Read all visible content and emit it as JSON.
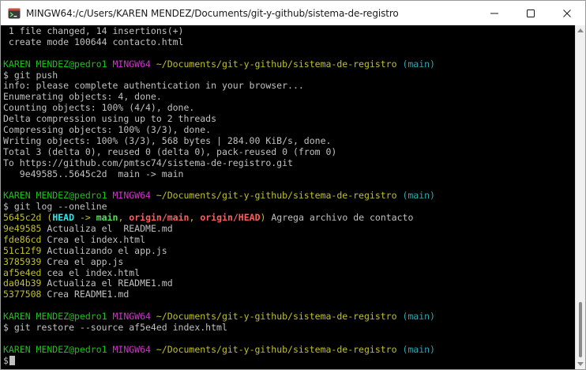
{
  "window": {
    "title": "MINGW64:/c/Users/KAREN MENDEZ/Documents/git-y-github/sistema-de-registro"
  },
  "icons": {
    "app": "mingw-terminal-icon",
    "minimize": "minimize-icon",
    "maximize": "maximize-icon",
    "close": "close-icon"
  },
  "colors": {
    "background": "#000000",
    "text": "#c0c0c0",
    "user_host": "#19c319",
    "system": "#c838c6",
    "path": "#c0c026",
    "branch": "#2aa9b0",
    "titlebar": "#ffffff"
  },
  "terminal": {
    "lines": [
      {
        "segments": [
          {
            "t": " 1 file changed, 14 insertions(+)"
          }
        ]
      },
      {
        "segments": [
          {
            "t": " create mode 100644 contacto.html"
          }
        ]
      },
      {
        "segments": [
          {
            "t": ""
          }
        ]
      },
      {
        "segments": [
          {
            "t": "KAREN MENDEZ@pedro1 ",
            "c": "green"
          },
          {
            "t": "MINGW64 ",
            "c": "magenta"
          },
          {
            "t": "~/Documents/git-y-github/sistema-de-registro ",
            "c": "yellow"
          },
          {
            "t": "(main)",
            "c": "cyan"
          }
        ]
      },
      {
        "segments": [
          {
            "t": "$ git push"
          }
        ]
      },
      {
        "segments": [
          {
            "t": "info: please complete authentication in your browser..."
          }
        ]
      },
      {
        "segments": [
          {
            "t": "Enumerating objects: 4, done."
          }
        ]
      },
      {
        "segments": [
          {
            "t": "Counting objects: 100% (4/4), done."
          }
        ]
      },
      {
        "segments": [
          {
            "t": "Delta compression using up to 2 threads"
          }
        ]
      },
      {
        "segments": [
          {
            "t": "Compressing objects: 100% (3/3), done."
          }
        ]
      },
      {
        "segments": [
          {
            "t": "Writing objects: 100% (3/3), 568 bytes | 284.00 KiB/s, done."
          }
        ]
      },
      {
        "segments": [
          {
            "t": "Total 3 (delta 0), reused 0 (delta 0), pack-reused 0 (from 0)"
          }
        ]
      },
      {
        "segments": [
          {
            "t": "To https://github.com/pmtsc74/sistema-de-registro.git"
          }
        ]
      },
      {
        "segments": [
          {
            "t": "   9e49585..5645c2d  main -> main"
          }
        ]
      },
      {
        "segments": [
          {
            "t": ""
          }
        ]
      },
      {
        "segments": [
          {
            "t": "KAREN MENDEZ@pedro1 ",
            "c": "green"
          },
          {
            "t": "MINGW64 ",
            "c": "magenta"
          },
          {
            "t": "~/Documents/git-y-github/sistema-de-registro ",
            "c": "yellow"
          },
          {
            "t": "(main)",
            "c": "cyan"
          }
        ]
      },
      {
        "segments": [
          {
            "t": "$ git log --oneline"
          }
        ]
      },
      {
        "segments": [
          {
            "t": "5645c2d ",
            "c": "yellow"
          },
          {
            "t": "(",
            "c": "yellow"
          },
          {
            "t": "HEAD",
            "c": "cyan-b"
          },
          {
            "t": " -> ",
            "c": "yellow"
          },
          {
            "t": "main",
            "c": "green-b"
          },
          {
            "t": ", ",
            "c": "yellow"
          },
          {
            "t": "origin/main",
            "c": "red-b"
          },
          {
            "t": ", ",
            "c": "yellow"
          },
          {
            "t": "origin/HEAD",
            "c": "red-b"
          },
          {
            "t": ")",
            "c": "yellow"
          },
          {
            "t": " Agrega archivo de contacto"
          }
        ]
      },
      {
        "segments": [
          {
            "t": "9e49585 ",
            "c": "yellow"
          },
          {
            "t": "Actualiza el  README.md"
          }
        ]
      },
      {
        "segments": [
          {
            "t": "fde86cd ",
            "c": "yellow"
          },
          {
            "t": "Crea el index.html"
          }
        ]
      },
      {
        "segments": [
          {
            "t": "51c12f9 ",
            "c": "yellow"
          },
          {
            "t": "Actualizando el app.js"
          }
        ]
      },
      {
        "segments": [
          {
            "t": "3785939 ",
            "c": "yellow"
          },
          {
            "t": "Crea el app.js"
          }
        ]
      },
      {
        "segments": [
          {
            "t": "af5e4ed ",
            "c": "yellow"
          },
          {
            "t": "cea el index.html"
          }
        ]
      },
      {
        "segments": [
          {
            "t": "da04b39 ",
            "c": "yellow"
          },
          {
            "t": "Actualiza el README1.md"
          }
        ]
      },
      {
        "segments": [
          {
            "t": "5377508 ",
            "c": "yellow"
          },
          {
            "t": "Crea README1.md"
          }
        ]
      },
      {
        "segments": [
          {
            "t": ""
          }
        ]
      },
      {
        "segments": [
          {
            "t": "KAREN MENDEZ@pedro1 ",
            "c": "green"
          },
          {
            "t": "MINGW64 ",
            "c": "magenta"
          },
          {
            "t": "~/Documents/git-y-github/sistema-de-registro ",
            "c": "yellow"
          },
          {
            "t": "(main)",
            "c": "cyan"
          }
        ]
      },
      {
        "segments": [
          {
            "t": "$ git restore --source af5e4ed index.html"
          }
        ]
      },
      {
        "segments": [
          {
            "t": ""
          }
        ]
      },
      {
        "segments": [
          {
            "t": "KAREN MENDEZ@pedro1 ",
            "c": "green"
          },
          {
            "t": "MINGW64 ",
            "c": "magenta"
          },
          {
            "t": "~/Documents/git-y-github/sistema-de-registro ",
            "c": "yellow"
          },
          {
            "t": "(main)",
            "c": "cyan"
          }
        ]
      },
      {
        "segments": [
          {
            "t": "$"
          }
        ],
        "cursor": true
      }
    ]
  }
}
